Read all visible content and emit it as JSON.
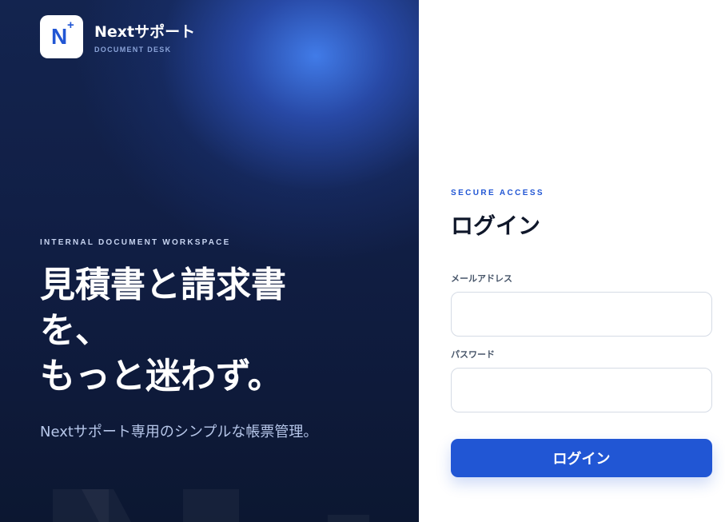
{
  "brand": {
    "logo_mark": "N",
    "logo_plus": "+",
    "name": "Nextサポート",
    "subtitle": "DOCUMENT DESK"
  },
  "hero": {
    "eyebrow": "INTERNAL DOCUMENT WORKSPACE",
    "headline_lines": [
      "見積書と請求書",
      "を、",
      "もっと迷わず。"
    ],
    "tagline": "Nextサポート専用のシンプルな帳票管理。"
  },
  "login": {
    "eyebrow": "SECURE ACCESS",
    "title": "ログイン",
    "email_label": "メールアドレス",
    "email_value": "",
    "password_label": "パスワード",
    "password_value": "",
    "button_label": "ログイン"
  },
  "colors": {
    "accent": "#2156d4",
    "panel_dark": "#0e1a3a",
    "glow": "#427de8"
  }
}
